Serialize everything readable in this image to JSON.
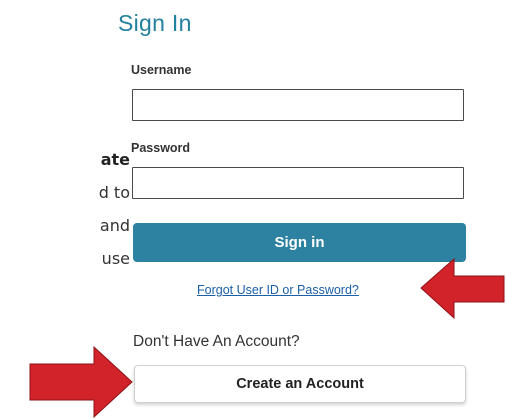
{
  "left_text": {
    "lines": [
      "ate",
      "d to",
      "and",
      "use"
    ]
  },
  "signin": {
    "title": "Sign In",
    "username_label": "Username",
    "username_value": "",
    "password_label": "Password",
    "password_value": "",
    "submit_label": "Sign in",
    "forgot_link": "Forgot User ID or Password?",
    "no_account_text": "Don't Have An Account?",
    "create_account_label": "Create an Account"
  },
  "annotations": {
    "arrow_color": "#d2232a",
    "arrows": [
      "arrow-pointing-left",
      "arrow-pointing-right"
    ]
  },
  "colors": {
    "accent": "#2c82a0",
    "title": "#23809f",
    "link": "#1a5fa8"
  }
}
